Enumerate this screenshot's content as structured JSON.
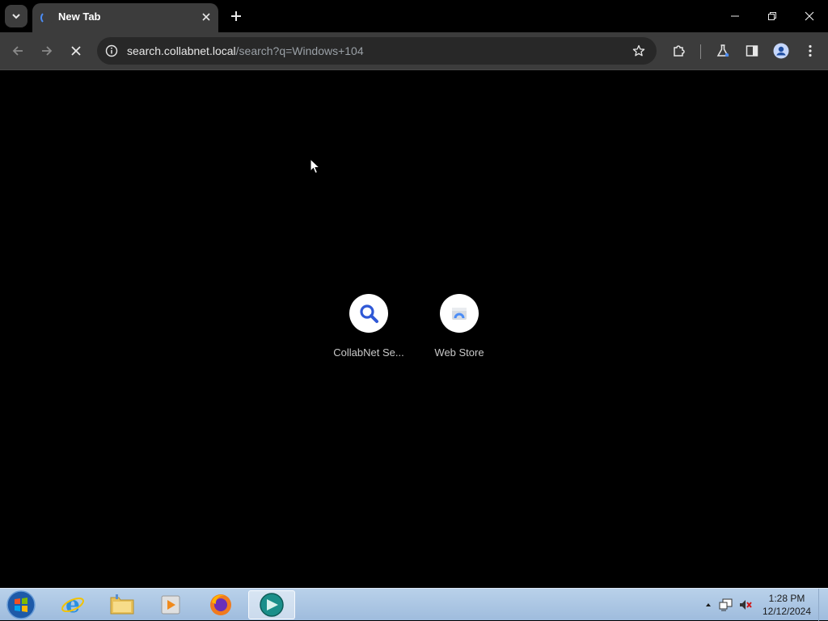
{
  "tab": {
    "title": "New Tab"
  },
  "omnibox": {
    "host": "search.collabnet.local",
    "path": "/search?q=Windows+104"
  },
  "shortcuts": [
    {
      "label": "CollabNet Se...",
      "icon": "magnifier-icon"
    },
    {
      "label": "Web Store",
      "icon": "web-store-icon"
    }
  ],
  "taskbar": {
    "apps": [
      "internet-explorer",
      "file-explorer",
      "media-player",
      "firefox",
      "browser-active"
    ],
    "clock": {
      "time": "1:28 PM",
      "date": "12/12/2024"
    }
  },
  "colors": {
    "accent": "#4c8df6",
    "toolbar": "#3c3c3c",
    "omnibox": "#282828",
    "content": "#000000"
  }
}
